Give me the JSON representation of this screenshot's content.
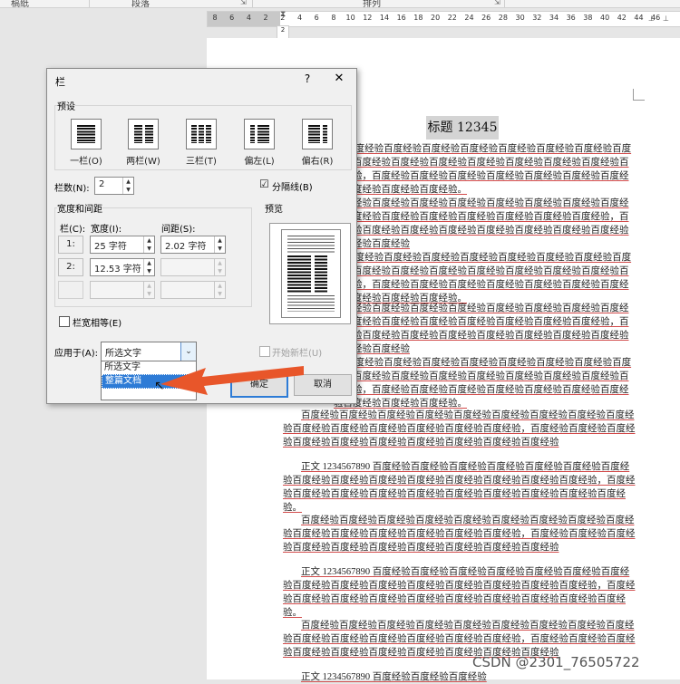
{
  "ribbon": {
    "labels": [
      "稿纸",
      "段落",
      "排列"
    ],
    "launchers": [
      "⇲",
      "⇲"
    ]
  },
  "ruler": {
    "ticks": [
      "8",
      "6",
      "4",
      "2",
      "2",
      "4",
      "6",
      "8",
      "10",
      "12",
      "14",
      "16",
      "18",
      "20",
      "22",
      "24",
      "26",
      "28",
      "30",
      "32",
      "34",
      "36",
      "38",
      "40",
      "42",
      "44",
      "46"
    ],
    "vruler": "2"
  },
  "document": {
    "title": "标题 12345",
    "paragraphs": [
      "90 百度经验百度经验百度经验百度经验百度经验百度经验百度经验百度经验百度经验百度经验百度经验百度经验百度经验百度经验百度经验百度经验，百度经验百度经验百度经验百度经验百度经验百度经验百度经验百度经验百度经验百度经验。",
      "百度经验百度经验百度经验百度经验百度经验百度经验百度经验百度经验百度经验百度经验百度经验百度经验百度经验百度经验百度经验，百度经验百度经验百度经验百度经验百度经验百度经验百度经验百度经验百度经验百度经验",
      "90 百度经验百度经验百度经验百度经验百度经验百度经验百度经验百度经验百度经验百度经验百度经验百度经验百度经验百度经验百度经验百度经验，百度经验百度经验百度经验百度经验百度经验百度经验百度经验百度经验百度经验百度经验。",
      "百度经验百度经验百度经验百度经验百度经验百度经验百度经验百度经验百度经验百度经验百度经验百度经验百度经验百度经验百度经验，百度经验百度经验百度经验百度经验百度经验百度经验百度经验百度经验百度经验百度经验",
      "90 百度经验百度经验百度经验百度经验百度经验百度经验百度经验百度经验百度经验百度经验百度经验百度经验百度经验百度经验百度经验百度经验，百度经验百度经验百度经验百度经验百度经验百度经验百度经验百度经验百度经验百度经验。",
      "百度经验百度经验百度经验百度经验百度经验百度经验百度经验百度经验百度经验百度经验百度经验百度经验百度经验百度经验百度经验，百度经验百度经验百度经验百度经验百度经验百度经验百度经验百度经验百度经验百度经验",
      "正文 1234567890 百度经验百度经验百度经验百度经验百度经验百度经验百度经验百度经验百度经验百度经验百度经验百度经验百度经验百度经验百度经验，百度经验百度经验百度经验百度经验百度经验百度经验百度经验百度经验百度经验百度经验。",
      "百度经验百度经验百度经验百度经验百度经验百度经验百度经验百度经验百度经验百度经验百度经验百度经验百度经验百度经验百度经验，百度经验百度经验百度经验百度经验百度经验百度经验百度经验百度经验百度经验百度经验",
      "正文 1234567890 百度经验百度经验百度经验百度经验百度经验百度经验百度经验百度经验百度经验百度经验百度经验百度经验百度经验百度经验百度经验，百度经验百度经验百度经验百度经验百度经验百度经验百度经验百度经验百度经验百度经验。",
      "百度经验百度经验百度经验百度经验百度经验百度经验百度经验百度经验百度经验百度经验百度经验百度经验百度经验百度经验百度经验，百度经验百度经验百度经验百度经验百度经验百度经验百度经验百度经验百度经验百度经验",
      "正文 1234567890 百度经验百度经验百度经验"
    ]
  },
  "dialog": {
    "title": "栏",
    "help": "?",
    "close": "✕",
    "presets_label": "预设",
    "presets": [
      {
        "label": "一栏(O)"
      },
      {
        "label": "两栏(W)"
      },
      {
        "label": "三栏(T)"
      },
      {
        "label": "偏左(L)"
      },
      {
        "label": "偏右(R)"
      }
    ],
    "num_columns_label": "栏数(N):",
    "num_columns": "2",
    "separator_label": "分隔线(B)",
    "separator_checked": "☑",
    "width_spacing_label": "宽度和间距",
    "col_header": "栏(C):",
    "width_header": "宽度(I):",
    "spacing_header": "间距(S):",
    "rows": [
      {
        "num": "1:",
        "width": "25 字符",
        "spacing": "2.02 字符"
      },
      {
        "num": "2:",
        "width": "12.53 字符",
        "spacing": ""
      },
      {
        "num": "",
        "width": "",
        "spacing": ""
      }
    ],
    "equal_width_label": "栏宽相等(E)",
    "preview_label": "预览",
    "apply_to_label": "应用于(A):",
    "apply_to_value": "所选文字",
    "apply_options": [
      "所选文字",
      "整篇文档"
    ],
    "new_column_label": "开始新栏(U)",
    "ok_label": "确定",
    "cancel_label": "取消"
  },
  "watermark": "CSDN @2301_76505722",
  "colors": {
    "accent": "#2d7bd6",
    "arrow": "#e8562a",
    "underline": "#d24b4b"
  }
}
